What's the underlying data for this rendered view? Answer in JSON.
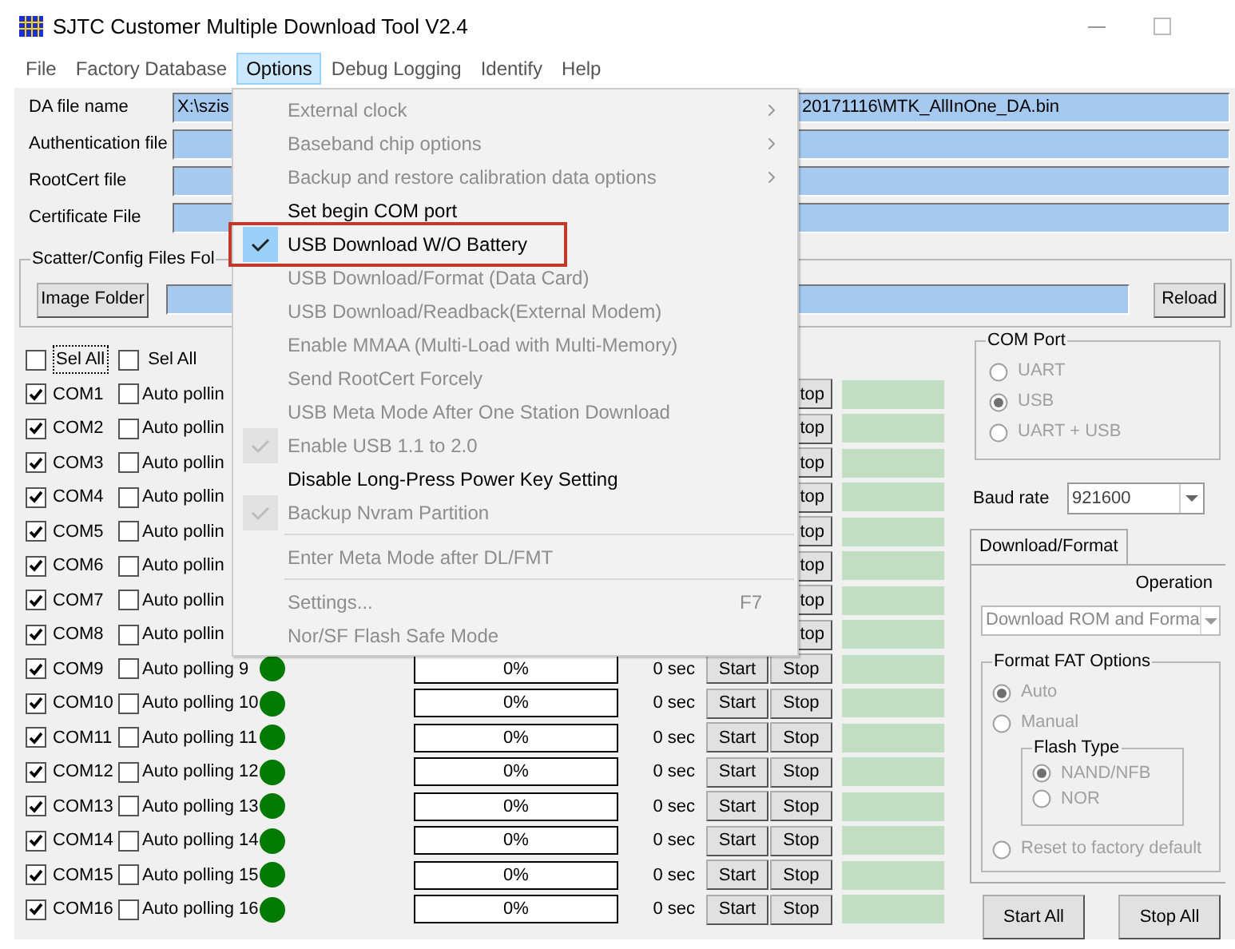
{
  "window": {
    "title": "SJTC Customer Multiple Download Tool V2.4"
  },
  "menu_bar": [
    {
      "label": "File",
      "selected": false
    },
    {
      "label": "Factory Database",
      "selected": false
    },
    {
      "label": "Options",
      "selected": true
    },
    {
      "label": "Debug Logging",
      "selected": false
    },
    {
      "label": "Identify",
      "selected": false
    },
    {
      "label": "Help",
      "selected": false
    }
  ],
  "file_fields": [
    {
      "label": "DA file name",
      "value_parts": [
        "X:\\szis",
        "20171116\\MTK_AllInOne_DA.bin"
      ]
    },
    {
      "label": "Authentication file"
    },
    {
      "label": "RootCert file"
    },
    {
      "label": "Certificate File"
    }
  ],
  "scatter_group": {
    "title": "Scatter/Config Files Fol",
    "button": "Image Folder",
    "reload": "Reload"
  },
  "select_all": [
    {
      "label": "Sel All",
      "checked": false,
      "focused": true
    },
    {
      "label": "Sel All",
      "checked": false,
      "focused": false
    }
  ],
  "ports": [
    {
      "com": "COM1",
      "checked": true,
      "polling": "Auto pollin",
      "polling_checked": false,
      "stop": "top"
    },
    {
      "com": "COM2",
      "checked": true,
      "polling": "Auto pollin",
      "polling_checked": false,
      "stop": "top"
    },
    {
      "com": "COM3",
      "checked": true,
      "polling": "Auto pollin",
      "polling_checked": false,
      "stop": "top"
    },
    {
      "com": "COM4",
      "checked": true,
      "polling": "Auto pollin",
      "polling_checked": false,
      "stop": "top"
    },
    {
      "com": "COM5",
      "checked": true,
      "polling": "Auto pollin",
      "polling_checked": false,
      "stop": "top"
    },
    {
      "com": "COM6",
      "checked": true,
      "polling": "Auto pollin",
      "polling_checked": false,
      "stop": "top"
    },
    {
      "com": "COM7",
      "checked": true,
      "polling": "Auto pollin",
      "polling_checked": false,
      "stop": "top"
    },
    {
      "com": "COM8",
      "checked": true,
      "polling": "Auto pollin",
      "polling_checked": false,
      "stop": "top"
    },
    {
      "com": "COM9",
      "checked": true,
      "polling": "Auto polling 9",
      "polling_checked": false,
      "lamp": true,
      "progress": "0%",
      "level": 0,
      "time": "0 sec",
      "start": "Start",
      "stop": "Stop"
    },
    {
      "com": "COM10",
      "checked": true,
      "polling": "Auto polling 10",
      "polling_checked": false,
      "lamp": true,
      "progress": "0%",
      "level": 0,
      "time": "0 sec",
      "start": "Start",
      "stop": "Stop"
    },
    {
      "com": "COM11",
      "checked": true,
      "polling": "Auto polling 11",
      "polling_checked": false,
      "lamp": true,
      "progress": "0%",
      "level": 0,
      "time": "0 sec",
      "start": "Start",
      "stop": "Stop"
    },
    {
      "com": "COM12",
      "checked": true,
      "polling": "Auto polling 12",
      "polling_checked": false,
      "lamp": true,
      "progress": "0%",
      "level": 0,
      "time": "0 sec",
      "start": "Start",
      "stop": "Stop"
    },
    {
      "com": "COM13",
      "checked": true,
      "polling": "Auto polling 13",
      "polling_checked": false,
      "lamp": true,
      "progress": "0%",
      "level": 0,
      "time": "0 sec",
      "start": "Start",
      "stop": "Stop"
    },
    {
      "com": "COM14",
      "checked": true,
      "polling": "Auto polling 14",
      "polling_checked": false,
      "lamp": true,
      "progress": "0%",
      "level": 0,
      "time": "0 sec",
      "start": "Start",
      "stop": "Stop"
    },
    {
      "com": "COM15",
      "checked": true,
      "polling": "Auto polling 15",
      "polling_checked": false,
      "lamp": true,
      "progress": "0%",
      "level": 0,
      "time": "0 sec",
      "start": "Start",
      "stop": "Stop"
    },
    {
      "com": "COM16",
      "checked": true,
      "polling": "Auto polling 16",
      "polling_checked": false,
      "lamp": true,
      "progress": "0%",
      "level": 0,
      "time": "0 sec",
      "start": "Start",
      "stop": "Stop"
    }
  ],
  "com_port": {
    "title": "COM Port",
    "disabled": true,
    "options": [
      {
        "label": "UART",
        "selected": false
      },
      {
        "label": "USB",
        "selected": true
      },
      {
        "label": "UART + USB",
        "selected": false
      }
    ]
  },
  "baud_rate": {
    "label": "Baud rate",
    "value": "921600"
  },
  "tabs": [
    {
      "label": "Download/Format",
      "selected": true
    }
  ],
  "operation": {
    "label": "Operation",
    "value": "Download ROM and Forma",
    "disabled": true
  },
  "format_fat": {
    "title": "Format FAT Options",
    "disabled": true,
    "options": [
      {
        "label": "Auto",
        "selected": true
      },
      {
        "label": "Manual",
        "selected": false
      }
    ],
    "flash_type": {
      "title": "Flash  Type",
      "options": [
        {
          "label": "NAND/NFB",
          "selected": true
        },
        {
          "label": "NOR",
          "selected": false
        }
      ]
    },
    "reset": {
      "label": "Reset to factory default",
      "selected": false
    }
  },
  "buttons": [
    "Start All",
    "Stop All"
  ],
  "options_menu": [
    {
      "kind": "item",
      "label": "External clock",
      "disabled": true,
      "checked": false,
      "submenu": true,
      "annotated": false
    },
    {
      "kind": "item",
      "label": "Baseband chip options",
      "disabled": true,
      "checked": false,
      "submenu": true,
      "annotated": false
    },
    {
      "kind": "item",
      "label": "Backup and restore calibration data options",
      "disabled": true,
      "checked": false,
      "submenu": true,
      "annotated": false
    },
    {
      "kind": "item",
      "label": "Set begin COM port",
      "disabled": false,
      "checked": false,
      "submenu": false,
      "annotated": false
    },
    {
      "kind": "item",
      "label": "USB Download W/O Battery",
      "disabled": false,
      "checked": true,
      "submenu": false,
      "annotated": true
    },
    {
      "kind": "item",
      "label": "USB Download/Format  (Data Card)",
      "disabled": true,
      "checked": false,
      "submenu": false,
      "annotated": false
    },
    {
      "kind": "item",
      "label": "USB Download/Readback(External Modem)",
      "disabled": true,
      "checked": false,
      "submenu": false,
      "annotated": false
    },
    {
      "kind": "item",
      "label": "Enable MMAA (Multi-Load with Multi-Memory)",
      "disabled": true,
      "checked": false,
      "submenu": false,
      "annotated": false
    },
    {
      "kind": "item",
      "label": "Send RootCert Forcely",
      "disabled": true,
      "checked": false,
      "submenu": false,
      "annotated": false
    },
    {
      "kind": "item",
      "label": "USB Meta Mode After One Station Download",
      "disabled": true,
      "checked": false,
      "submenu": false,
      "annotated": false
    },
    {
      "kind": "item",
      "label": "Enable USB 1.1 to 2.0",
      "disabled": true,
      "checked": true,
      "submenu": false,
      "annotated": false
    },
    {
      "kind": "item",
      "label": "Disable Long-Press Power Key Setting",
      "disabled": false,
      "checked": false,
      "submenu": false,
      "annotated": false
    },
    {
      "kind": "item",
      "label": "Backup Nvram Partition",
      "disabled": true,
      "checked": true,
      "submenu": false,
      "annotated": false
    },
    {
      "kind": "separator"
    },
    {
      "kind": "item",
      "label": "Enter Meta Mode after DL/FMT",
      "disabled": true,
      "checked": false,
      "submenu": false,
      "annotated": false
    },
    {
      "kind": "separator"
    },
    {
      "kind": "item",
      "label": "Settings...",
      "disabled": true,
      "checked": false,
      "submenu": false,
      "annotated": false,
      "shortcut": "F7"
    },
    {
      "kind": "item",
      "label": "Nor/SF Flash Safe Mode",
      "disabled": true,
      "checked": false,
      "submenu": false,
      "annotated": false
    }
  ]
}
